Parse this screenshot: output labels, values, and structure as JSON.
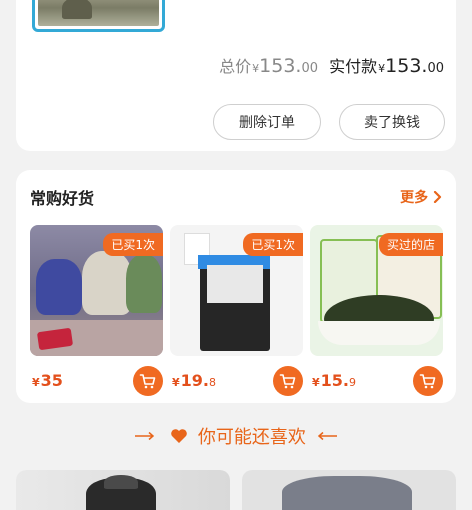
{
  "order": {
    "total_label": "总价",
    "total_symbol": "¥",
    "total_int": "153.",
    "total_dec": "00",
    "paid_label": "实付款",
    "paid_symbol": "¥",
    "paid_int": "153.",
    "paid_dec": "00",
    "delete_label": "删除订单",
    "sell_label": "卖了换钱"
  },
  "frequent": {
    "title": "常购好货",
    "more_label": "更多",
    "products": [
      {
        "badge": "已买1次",
        "symbol": "¥",
        "price_int": "35",
        "price_dec": "",
        "image": "anime-figures"
      },
      {
        "badge": "已买1次",
        "symbol": "¥",
        "price_int": "19.",
        "price_dec": "8",
        "image": "oil-blotting-paper"
      },
      {
        "badge": "买过的店",
        "symbol": "¥",
        "price_int": "15.",
        "price_dec": "9",
        "image": "seaweed-snack"
      }
    ]
  },
  "guess": {
    "title": "你可能还喜欢"
  },
  "colors": {
    "accent": "#f06a22",
    "price": "#e3501c",
    "thumb_border": "#33a9d6"
  },
  "icons": {
    "cart": "cart-icon",
    "heart": "heart-icon",
    "chevron": "chevron-right-icon"
  }
}
